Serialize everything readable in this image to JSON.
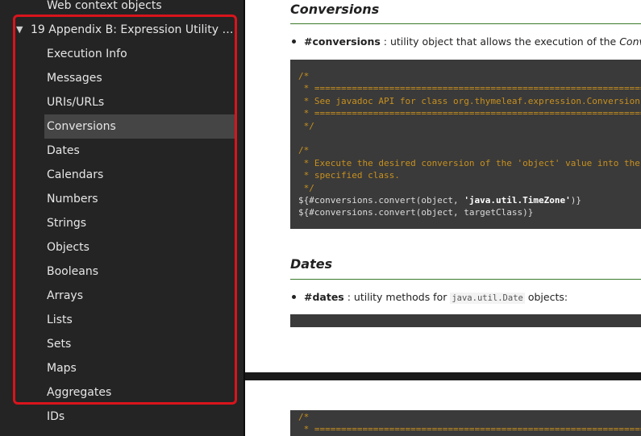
{
  "sidebar": {
    "top_item": "Web context objects",
    "parent": {
      "arrow": "▼",
      "label": "19 Appendix B: Expression Utility Obj…"
    },
    "items": [
      {
        "label": "Execution Info",
        "active": false
      },
      {
        "label": "Messages",
        "active": false
      },
      {
        "label": "URIs/URLs",
        "active": false
      },
      {
        "label": "Conversions",
        "active": true
      },
      {
        "label": "Dates",
        "active": false
      },
      {
        "label": "Calendars",
        "active": false
      },
      {
        "label": "Numbers",
        "active": false
      },
      {
        "label": "Strings",
        "active": false
      },
      {
        "label": "Objects",
        "active": false
      },
      {
        "label": "Booleans",
        "active": false
      },
      {
        "label": "Arrays",
        "active": false
      },
      {
        "label": "Lists",
        "active": false
      },
      {
        "label": "Sets",
        "active": false
      },
      {
        "label": "Maps",
        "active": false
      },
      {
        "label": "Aggregates",
        "active": false
      },
      {
        "label": "IDs",
        "active": false
      }
    ],
    "highlight_color": "#d9141c"
  },
  "content": {
    "conversions": {
      "heading": "Conversions",
      "bullet_key": "#conversions",
      "bullet_text": " : utility object that allows the execution of the ",
      "bullet_ital": "Conversion S",
      "code": [
        {
          "t": "cm",
          "v": "/*"
        },
        {
          "t": "cm",
          "v": " * ========================================================================="
        },
        {
          "t": "cm",
          "v": " * See javadoc API for class org.thymeleaf.expression.Conversions"
        },
        {
          "t": "cm",
          "v": " * ========================================================================="
        },
        {
          "t": "cm",
          "v": " */"
        },
        {
          "t": "cm",
          "v": " "
        },
        {
          "t": "cm",
          "v": "/*"
        },
        {
          "t": "cm",
          "v": " * Execute the desired conversion of the 'object' value into the"
        },
        {
          "t": "cm",
          "v": " * specified class."
        },
        {
          "t": "cm",
          "v": " */"
        },
        {
          "t": "ex1",
          "pre": "${#conversions.convert(object, ",
          "str": "'java.util.TimeZone'",
          "post": ")}"
        },
        {
          "t": "ex",
          "v": "${#conversions.convert(object, targetClass)}"
        }
      ]
    },
    "dates": {
      "heading": "Dates",
      "bullet_key": "#dates",
      "bullet_text": " : utility methods for ",
      "bullet_code": "java.util.Date",
      "bullet_tail": " objects:"
    },
    "next_page_code": [
      {
        "t": "cm",
        "v": "/*"
      },
      {
        "t": "cm",
        "v": " * ========================================================================="
      }
    ]
  },
  "colors": {
    "sidebar_bg": "#242424",
    "active_bg": "#454545",
    "code_bg": "#3a3a3a",
    "comment": "#c8901e",
    "rule": "#3a7a2a"
  }
}
